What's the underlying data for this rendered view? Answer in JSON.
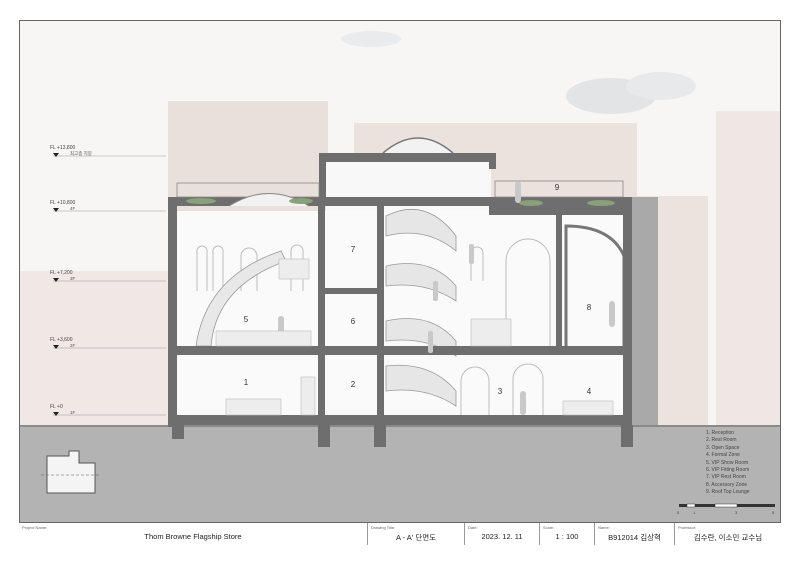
{
  "levels": [
    {
      "main": "FL +13,800",
      "sub": "최고층 지붕"
    },
    {
      "main": "FL +10,800",
      "sub": "4F"
    },
    {
      "main": "FL +7,200",
      "sub": "3F"
    },
    {
      "main": "FL +3,600",
      "sub": "2F"
    },
    {
      "main": "FL +0",
      "sub": "1F"
    }
  ],
  "room_numbers": [
    "1",
    "2",
    "3",
    "4",
    "5",
    "6",
    "7",
    "8",
    "9"
  ],
  "legend": [
    "1.  Reception",
    "2.  Rest Room",
    "3.  Open Space",
    "4.  Formal Zone",
    "5.  VIP Show Room",
    "6.  VIP Fitting Room",
    "7.  VIP Rest Room",
    "8.  Accessory Zone",
    "9.  Roof Top Lounge"
  ],
  "scale_bar": {
    "ticks": [
      "0",
      "1",
      "3",
      "5"
    ]
  },
  "title_block": {
    "project_label": "Project Name:",
    "project": "Thom Browne Flagship Store",
    "drawing_label": "Drawing Title:",
    "drawing": "A - A' 단면도",
    "date_label": "Date:",
    "date": "2023. 12. 11",
    "scale_label": "Scale:",
    "scale": "1 : 100",
    "name_label": "Name:",
    "name": "B912014 김상혁",
    "professor_label": "Professor:",
    "professor": "김수란, 이소민 교수님"
  },
  "colors": {
    "wall": "#6e6e6e",
    "ground": "#b3b3b3",
    "background_building": "#e7dcd8",
    "interior": "#f9f9f9"
  }
}
